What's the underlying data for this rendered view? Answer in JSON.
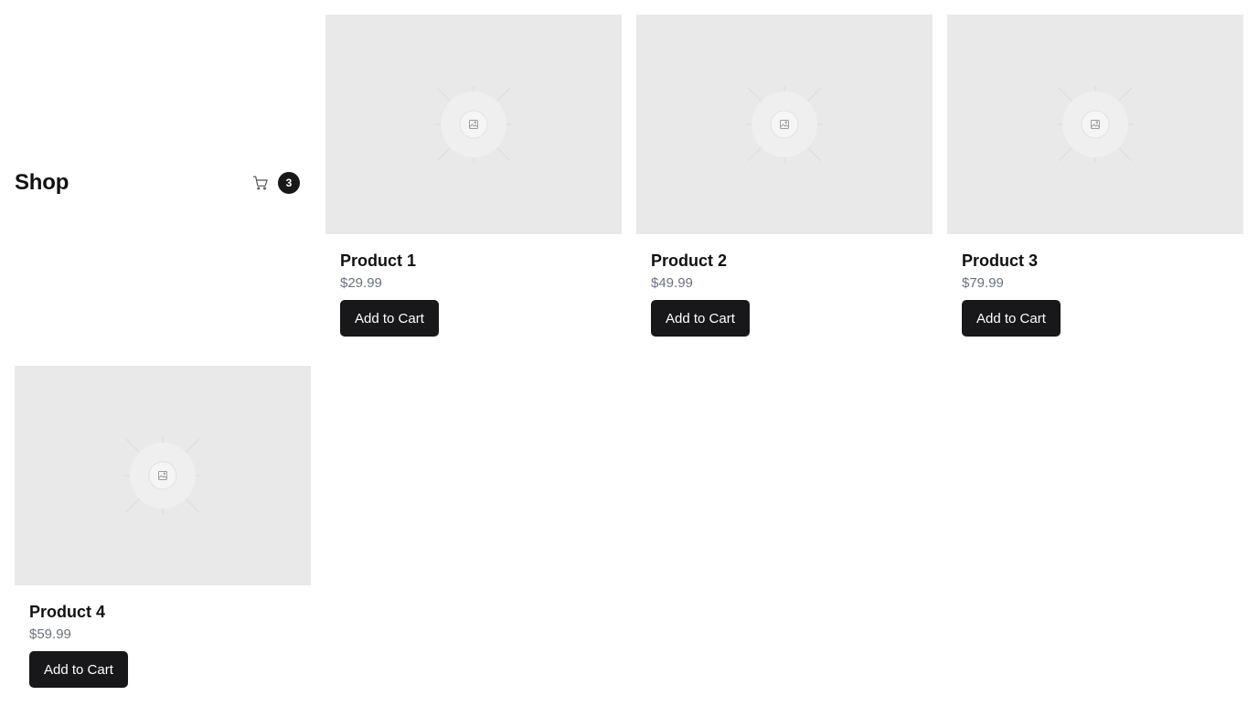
{
  "header": {
    "title": "Shop",
    "cart_icon": "cart-icon",
    "cart_count": "3"
  },
  "products": [
    {
      "name": "Product 1",
      "price": "$29.99",
      "button_label": "Add to Cart",
      "image_icon": "image-placeholder-icon"
    },
    {
      "name": "Product 2",
      "price": "$49.99",
      "button_label": "Add to Cart",
      "image_icon": "image-placeholder-icon"
    },
    {
      "name": "Product 3",
      "price": "$79.99",
      "button_label": "Add to Cart",
      "image_icon": "image-placeholder-icon"
    },
    {
      "name": "Product 4",
      "price": "$59.99",
      "button_label": "Add to Cart",
      "image_icon": "image-placeholder-icon"
    }
  ],
  "colors": {
    "button_bg": "#18181b",
    "placeholder_bg": "#e9e9e9",
    "price_text": "#6b7280"
  }
}
